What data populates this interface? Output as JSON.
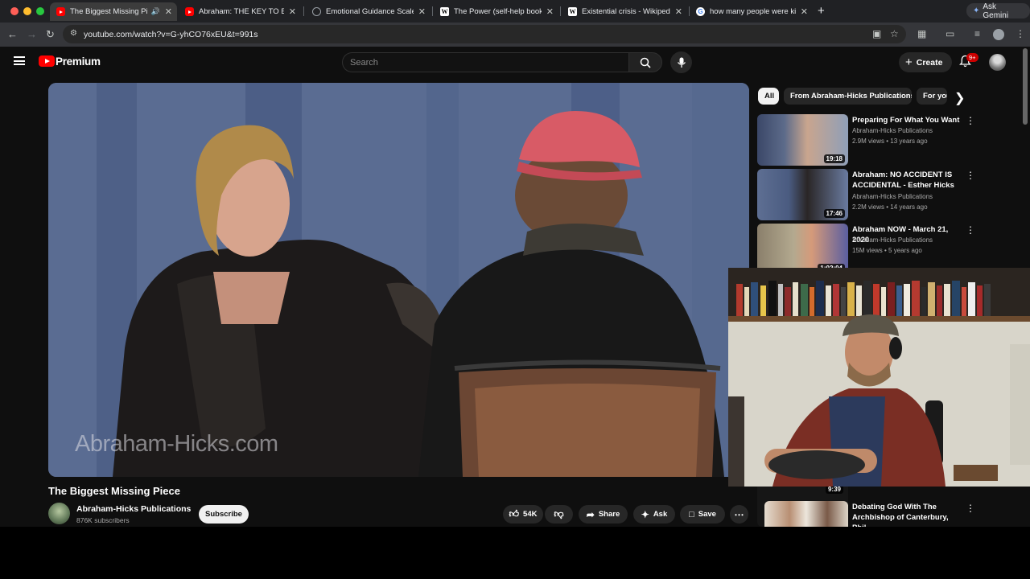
{
  "browser": {
    "tabs": [
      {
        "title": "The Biggest Missing Piece",
        "icon": "youtube-icon",
        "active": true,
        "audio": true
      },
      {
        "title": "Abraham: THE KEY TO EFFOR",
        "icon": "youtube-icon"
      },
      {
        "title": "Emotional Guidance Scale - H",
        "icon": "globe-icon"
      },
      {
        "title": "The Power (self-help book) -",
        "icon": "wikipedia-icon"
      },
      {
        "title": "Existential crisis - Wikipedia",
        "icon": "wikipedia-icon"
      },
      {
        "title": "how many people were killed",
        "icon": "google-icon"
      }
    ],
    "ask_gemini": "Ask Gemini",
    "url": "youtube.com/watch?v=G-yhCO76xEU&t=991s"
  },
  "yt": {
    "brand": "Premium",
    "search_placeholder": "Search",
    "create_label": "Create",
    "notification_badge": "9+"
  },
  "video": {
    "watermark": "Abraham-Hicks.com",
    "title": "The Biggest Missing Piece",
    "channel": "Abraham-Hicks Publications",
    "subscribers": "876K subscribers",
    "subscribe_label": "Subscribe",
    "likes": "54K",
    "share_label": "Share",
    "ask_label": "Ask",
    "save_label": "Save"
  },
  "sidebar": {
    "chips": [
      "All",
      "From Abraham-Hicks Publications",
      "For you"
    ],
    "recommendations": [
      {
        "title": "Preparing For What You Want",
        "channel": "Abraham-Hicks Publications",
        "meta": "2.9M views • 13 years ago",
        "duration": "19:18"
      },
      {
        "title": "Abraham: NO ACCIDENT IS ACCIDENTAL - Esther Hicks",
        "channel": "Abraham-Hicks Publications",
        "meta": "2.2M views • 14 years ago",
        "duration": "17:46"
      },
      {
        "title": "Abraham NOW - March 21, 2020",
        "channel": "Abraham-Hicks Publications",
        "meta": "15M views • 5 years ago",
        "duration": "1:02:04"
      },
      {
        "title": "Debating God With The Archbishop of Canterbury, Phil...",
        "duration": "9:39"
      }
    ]
  },
  "colors": {
    "yt_red": "#ff0000",
    "background": "#0f0f0f",
    "chip_bg": "#272727"
  }
}
